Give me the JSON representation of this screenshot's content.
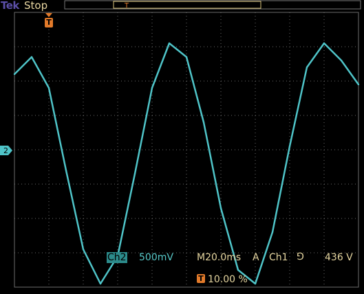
{
  "header": {
    "brand": "Tek",
    "status": "Stop"
  },
  "channel": {
    "tag": "Ch2",
    "scale": "500mV",
    "marker": "2"
  },
  "timebase": "M20.0ms",
  "trigger": {
    "mode": "A",
    "source": "Ch1",
    "slope_symbol": "⅁",
    "level": "436 V",
    "icon": "T",
    "position": "10.00 %"
  },
  "colors": {
    "background": "#000000",
    "graticule": "#6b6b6b",
    "trace": "#4fc4c8",
    "trigger": "#e27a2a",
    "readout": "#e6d6a0",
    "brand": "#5b4fa8"
  },
  "chart_data": {
    "type": "line",
    "title": "",
    "xlabel": "",
    "ylabel": "",
    "x_unit": "ms",
    "y_unit": "V",
    "xlim": [
      0,
      200
    ],
    "ylim": [
      -2,
      2
    ],
    "grid": true,
    "grid_divisions": [
      10,
      8
    ],
    "series": [
      {
        "values": [
          {
            "x": 0,
            "y": 1.1
          },
          {
            "x": 10,
            "y": 1.35
          },
          {
            "x": 20,
            "y": 0.9
          },
          {
            "x": 30,
            "y": -0.3
          },
          {
            "x": 40,
            "y": -1.45
          },
          {
            "x": 50,
            "y": -1.95
          },
          {
            "x": 60,
            "y": -1.55
          },
          {
            "x": 70,
            "y": -0.35
          },
          {
            "x": 80,
            "y": 0.9
          },
          {
            "x": 90,
            "y": 1.55
          },
          {
            "x": 100,
            "y": 1.35
          },
          {
            "x": 110,
            "y": 0.4
          },
          {
            "x": 120,
            "y": -0.85
          },
          {
            "x": 130,
            "y": -1.75
          },
          {
            "x": 140,
            "y": -1.95
          },
          {
            "x": 150,
            "y": -1.2
          },
          {
            "x": 160,
            "y": 0.05
          },
          {
            "x": 170,
            "y": 1.2
          },
          {
            "x": 180,
            "y": 1.55
          },
          {
            "x": 190,
            "y": 1.3
          },
          {
            "x": 200,
            "y": 0.95
          }
        ]
      }
    ]
  }
}
